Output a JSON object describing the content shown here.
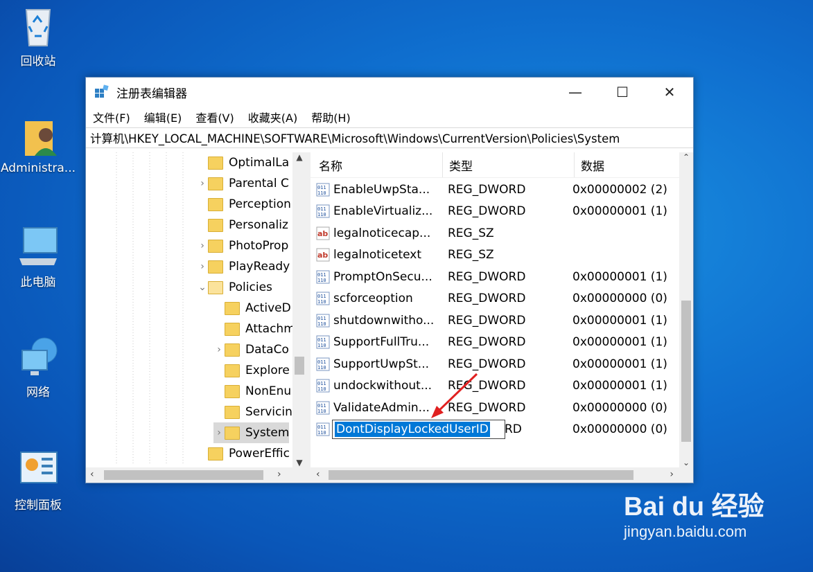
{
  "desktop": {
    "icons": [
      {
        "label": "回收站",
        "icon": "recycle-bin-icon"
      },
      {
        "label": "Administra...",
        "icon": "user-folder-icon"
      },
      {
        "label": "此电脑",
        "icon": "this-pc-icon"
      },
      {
        "label": "网络",
        "icon": "network-icon"
      },
      {
        "label": "控制面板",
        "icon": "control-panel-icon"
      }
    ]
  },
  "window": {
    "title": "注册表编辑器",
    "controls": {
      "minimize": "—",
      "maximize": "☐",
      "close": "✕"
    },
    "menu": [
      "文件(F)",
      "编辑(E)",
      "查看(V)",
      "收藏夹(A)",
      "帮助(H)"
    ],
    "address": "计算机\\HKEY_LOCAL_MACHINE\\SOFTWARE\\Microsoft\\Windows\\CurrentVersion\\Policies\\System"
  },
  "tree": {
    "items": [
      {
        "label": "OptimalLa",
        "chevron": ""
      },
      {
        "label": "Parental C",
        "chevron": "›"
      },
      {
        "label": "Perception",
        "chevron": ""
      },
      {
        "label": "Personaliz",
        "chevron": ""
      },
      {
        "label": "PhotoProp",
        "chevron": "›"
      },
      {
        "label": "PlayReady",
        "chevron": "›"
      },
      {
        "label": "Policies",
        "chevron": "⌄"
      },
      {
        "label": "ActiveD",
        "chevron": ""
      },
      {
        "label": "Attachm",
        "chevron": ""
      },
      {
        "label": "DataCo",
        "chevron": "›"
      },
      {
        "label": "Explore",
        "chevron": ""
      },
      {
        "label": "NonEnu",
        "chevron": ""
      },
      {
        "label": "Servicin",
        "chevron": ""
      },
      {
        "label": "System",
        "chevron": "›"
      },
      {
        "label": "PowerEffic",
        "chevron": ""
      }
    ]
  },
  "list": {
    "headers": {
      "name": "名称",
      "type": "类型",
      "data": "数据"
    },
    "rows": [
      {
        "name": "EnableUwpSta...",
        "type": "REG_DWORD",
        "data": "0x00000002 (2)",
        "icon": "dword-icon"
      },
      {
        "name": "EnableVirtualiz...",
        "type": "REG_DWORD",
        "data": "0x00000001 (1)",
        "icon": "dword-icon"
      },
      {
        "name": "legalnoticecap...",
        "type": "REG_SZ",
        "data": "",
        "icon": "string-icon"
      },
      {
        "name": "legalnoticetext",
        "type": "REG_SZ",
        "data": "",
        "icon": "string-icon"
      },
      {
        "name": "PromptOnSecu...",
        "type": "REG_DWORD",
        "data": "0x00000001 (1)",
        "icon": "dword-icon"
      },
      {
        "name": "scforceoption",
        "type": "REG_DWORD",
        "data": "0x00000000 (0)",
        "icon": "dword-icon"
      },
      {
        "name": "shutdownwitho...",
        "type": "REG_DWORD",
        "data": "0x00000001 (1)",
        "icon": "dword-icon"
      },
      {
        "name": "SupportFullTru...",
        "type": "REG_DWORD",
        "data": "0x00000001 (1)",
        "icon": "dword-icon"
      },
      {
        "name": "SupportUwpSt...",
        "type": "REG_DWORD",
        "data": "0x00000001 (1)",
        "icon": "dword-icon"
      },
      {
        "name": "undockwithout...",
        "type": "REG_DWORD",
        "data": "0x00000001 (1)",
        "icon": "dword-icon"
      },
      {
        "name": "ValidateAdmin...",
        "type": "REG_DWORD",
        "data": "0x00000000 (0)",
        "icon": "dword-icon"
      },
      {
        "name": "",
        "type": "RD",
        "data": "0x00000000 (0)",
        "icon": "dword-icon"
      }
    ],
    "edit_value": "DontDisplayLockedUserID"
  },
  "watermark": {
    "brand": "Bai du 经验",
    "url": "jingyan.baidu.com"
  }
}
